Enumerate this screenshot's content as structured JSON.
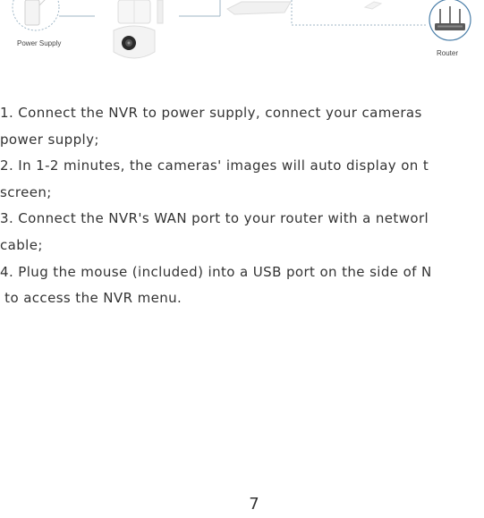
{
  "diagram": {
    "labels": {
      "power_supply": "Power Supply",
      "router": "Router"
    },
    "icons": [
      "power-adapter-icon",
      "ptz-camera-icon",
      "nvr-icon",
      "router-icon"
    ]
  },
  "instructions": {
    "lines": [
      "1. Connect the NVR  to power supply, connect your cameras",
      "power supply;",
      "2. In 1-2 minutes, the cameras' images will auto display on t",
      "screen;",
      "3. Connect the NVR's WAN port to your router with a networl",
      "cable;",
      "4. Plug the mouse (included) into a USB port on the side of N",
      " to access the NVR menu."
    ]
  },
  "page_number": "7"
}
